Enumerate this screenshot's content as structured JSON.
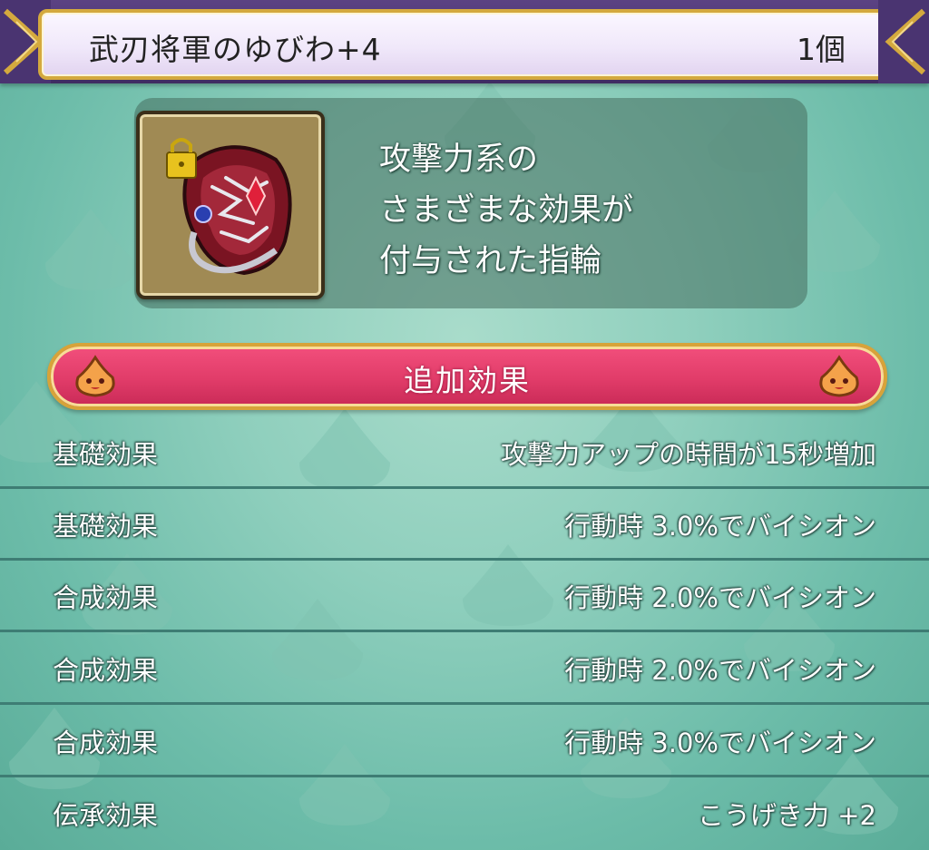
{
  "header": {
    "item_name": "武刃将軍のゆびわ+4",
    "count": "1個"
  },
  "item": {
    "icon": "ring-locked-icon",
    "description_lines": [
      "攻撃力系の",
      "さまざまな効果が",
      "付与された指輪"
    ]
  },
  "section": {
    "title": "追加効果"
  },
  "effects": [
    {
      "label": "基礎効果",
      "value": "攻撃力アップの時間が15秒増加"
    },
    {
      "label": "基礎効果",
      "value": "行動時 3.0%でバイシオン"
    },
    {
      "label": "合成効果",
      "value": "行動時 2.0%でバイシオン"
    },
    {
      "label": "合成効果",
      "value": "行動時 2.0%でバイシオン"
    },
    {
      "label": "合成効果",
      "value": "行動時 3.0%でバイシオン"
    },
    {
      "label": "伝承効果",
      "value": "こうげき力 +2"
    }
  ],
  "colors": {
    "header_frame": "#5b4283",
    "gold_trim": "#d4a93e",
    "banner": "#e13c69",
    "background": "#8fcfbd"
  }
}
